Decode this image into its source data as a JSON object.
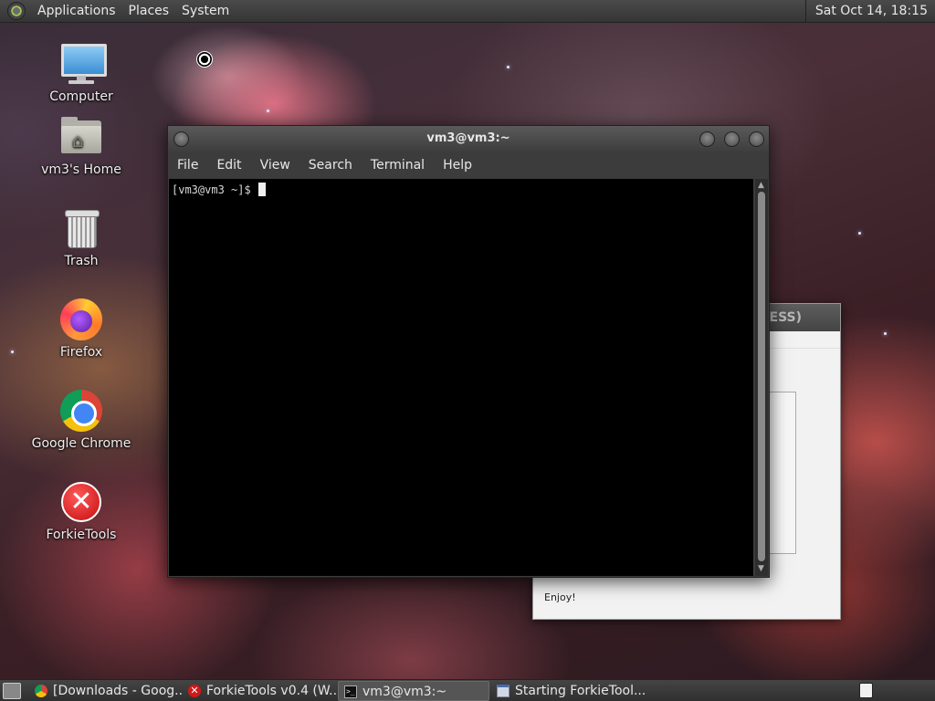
{
  "top_panel": {
    "menu_applications": "Applications",
    "menu_places": "Places",
    "menu_system": "System",
    "clock": "Sat Oct 14, 18:15"
  },
  "desktop_icons": [
    {
      "label": "Computer",
      "icon": "computer-icon"
    },
    {
      "label": "vm3's Home",
      "icon": "home-folder-icon"
    },
    {
      "label": "Trash",
      "icon": "trash-icon"
    },
    {
      "label": "Firefox",
      "icon": "firefox-icon"
    },
    {
      "label": "Google Chrome",
      "icon": "chrome-icon"
    },
    {
      "label": "ForkieTools",
      "icon": "forkietools-icon"
    }
  ],
  "terminal": {
    "title": "vm3@vm3:~",
    "menus": [
      "File",
      "Edit",
      "View",
      "Search",
      "Terminal",
      "Help"
    ],
    "prompt": "[vm3@vm3 ~]$"
  },
  "background_dialog": {
    "title_fragment": "RESS)",
    "footer_text": "Enjoy!"
  },
  "taskbar": {
    "tasks": [
      {
        "label": "[Downloads - Goog...",
        "icon": "chrome-icon",
        "active": false
      },
      {
        "label": "ForkieTools v0.4 (W...",
        "icon": "forkietools-icon",
        "active": false
      },
      {
        "label": "vm3@vm3:~",
        "icon": "terminal-icon",
        "active": true
      },
      {
        "label": "Starting ForkieTool...",
        "icon": "window-icon",
        "active": false
      }
    ]
  },
  "colors": {
    "panel": "#3d3d3d",
    "terminal_bg": "#000000",
    "terminal_fg": "#d8d8d8",
    "forkie_red": "#d21818"
  }
}
